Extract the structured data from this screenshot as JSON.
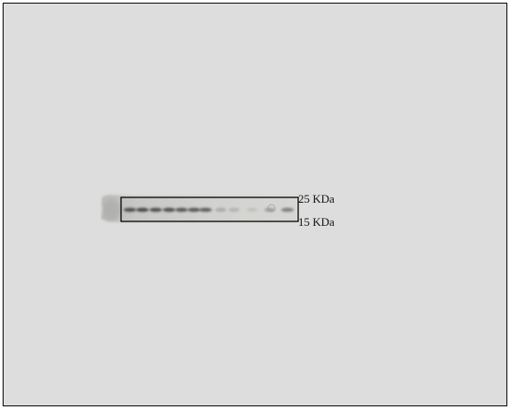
{
  "figure": {
    "markers": [
      {
        "label": "25 KDa"
      },
      {
        "label": "15 KDa"
      }
    ],
    "band_count": 12,
    "background_color": "#dcdddc",
    "frame_color": "#000000"
  }
}
